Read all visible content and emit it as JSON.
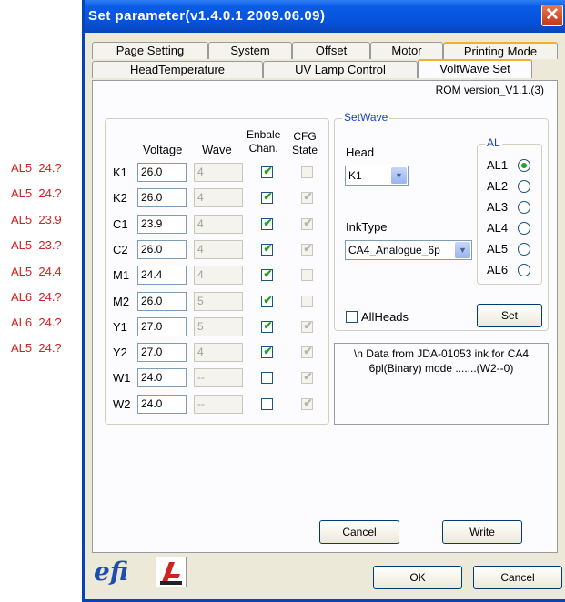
{
  "side_labels": [
    "AL5  24.?",
    "AL5  24.?",
    "AL5  23.9",
    "AL5  23.?",
    "AL5  24.4",
    "AL6  24.?",
    "AL6  24.?",
    "AL5  24.?"
  ],
  "window": {
    "title": "Set parameter(v1.4.0.1 2009.06.09)",
    "close_symbol": "✕"
  },
  "tabs_row1": [
    "Page Setting",
    "System",
    "Offset",
    "Motor",
    "Printing Mode"
  ],
  "tabs_row2": [
    "HeadTemperature",
    "UV Lamp Control",
    "VoltWave Set"
  ],
  "rom_version": "ROM version_V1.1.(3)",
  "table": {
    "headers": {
      "voltage": "Voltage",
      "wave": "Wave",
      "enable_l1": "Enbale",
      "enable_l2": "Chan.",
      "cfg_l1": "CFG",
      "cfg_l2": "State"
    },
    "rows": [
      {
        "name": "K1",
        "voltage": "26.0",
        "wave": "4",
        "enable": true,
        "cfg": false
      },
      {
        "name": "K2",
        "voltage": "26.0",
        "wave": "4",
        "enable": true,
        "cfg": true
      },
      {
        "name": "C1",
        "voltage": "23.9",
        "wave": "4",
        "enable": true,
        "cfg": true
      },
      {
        "name": "C2",
        "voltage": "26.0",
        "wave": "4",
        "enable": true,
        "cfg": true
      },
      {
        "name": "M1",
        "voltage": "24.4",
        "wave": "4",
        "enable": true,
        "cfg": false
      },
      {
        "name": "M2",
        "voltage": "26.0",
        "wave": "5",
        "enable": true,
        "cfg": false
      },
      {
        "name": "Y1",
        "voltage": "27.0",
        "wave": "5",
        "enable": true,
        "cfg": true
      },
      {
        "name": "Y2",
        "voltage": "27.0",
        "wave": "4",
        "enable": true,
        "cfg": true
      },
      {
        "name": "W1",
        "voltage": "24.0",
        "wave": "--",
        "enable": false,
        "cfg": true
      },
      {
        "name": "W2",
        "voltage": "24.0",
        "wave": "--",
        "enable": false,
        "cfg": true
      }
    ]
  },
  "setwave": {
    "title": "SetWave",
    "head_label": "Head",
    "head_value": "K1",
    "inktype_label": "InkType",
    "inktype_value": "CA4_Analogue_6p",
    "al_title": "AL",
    "al_options": [
      "AL1",
      "AL2",
      "AL3",
      "AL4",
      "AL5",
      "AL6"
    ],
    "al_selected": "AL1",
    "allheads_label": "AllHeads",
    "allheads_checked": false,
    "set_label": "Set"
  },
  "info_text": "\\n Data from JDA-01053 ink for CA4 6pl(Binary) mode .......(W2--0)",
  "cancel_label": "Cancel",
  "write_label": "Write",
  "footer": {
    "logo_text": "efi",
    "ok_label": "OK",
    "cancel_label": "Cancel"
  },
  "colors": {
    "check": "#21a121",
    "side_label": "#d42020",
    "title_bar": "#0651d9"
  }
}
